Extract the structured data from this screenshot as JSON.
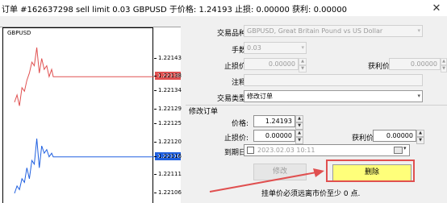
{
  "window": {
    "title": "订单 #162637298 sell limit 0.03 GBPUSD 于价格: 1.24193 止损: 0.00000 获利: 0.00000",
    "close_glyph": "✕"
  },
  "chart": {
    "symbol": "GBPUSD",
    "price_ticks": [
      "1.22143",
      "1.22138",
      "1.22134",
      "1.22129",
      "1.22125",
      "1.22120",
      "1.22116",
      "1.22111",
      "1.22106"
    ],
    "ask_price": "1.22138",
    "bid_price": "1.22116",
    "ask_color": "#e05050",
    "bid_color": "#2060e0",
    "ask_line": [
      1.22131,
      1.22133,
      1.2213,
      1.22135,
      1.22134,
      1.22137,
      1.22139,
      1.22142,
      1.22141,
      1.22146,
      1.22139,
      1.22143,
      1.2214,
      1.22141,
      1.22138,
      1.2214,
      1.22138,
      1.22138,
      1.22138
    ],
    "bid_line": [
      1.22106,
      1.22108,
      1.22107,
      1.2211,
      1.22109,
      1.22113,
      1.2211,
      1.22115,
      1.22114,
      1.22121,
      1.22113,
      1.22119,
      1.22117,
      1.22118,
      1.22116,
      1.22117,
      1.22116,
      1.22116,
      1.22116
    ]
  },
  "form": {
    "symbol_label": "交易品种:",
    "symbol_value": "GBPUSD, Great Britain Pound vs US Dollar",
    "volume_label": "手数:",
    "volume_value": "0.03",
    "sl_label": "止损价:",
    "sl_value": "0.00000",
    "tp_label": "获利价:",
    "tp_value": "0.00000",
    "comment_label": "注释:",
    "comment_value": "",
    "type_label": "交易类型:",
    "type_value": "修改订单",
    "dropdown_arrow": "▾"
  },
  "modify_section": {
    "title": "修改订单",
    "price_label": "价格:",
    "price_value": "1.24193",
    "sl_label": "止损价:",
    "sl_value": "0.00000",
    "tp_label": "获利价:",
    "tp_value": "0.00000",
    "expiry_label": "到期日:",
    "expiry_value": "2023.02.03 10:11",
    "modify_button": "修改",
    "delete_button": "删除",
    "status_text": "挂单价必须远离市价至少 0 点."
  },
  "annotation": {
    "color": "#e05050"
  }
}
